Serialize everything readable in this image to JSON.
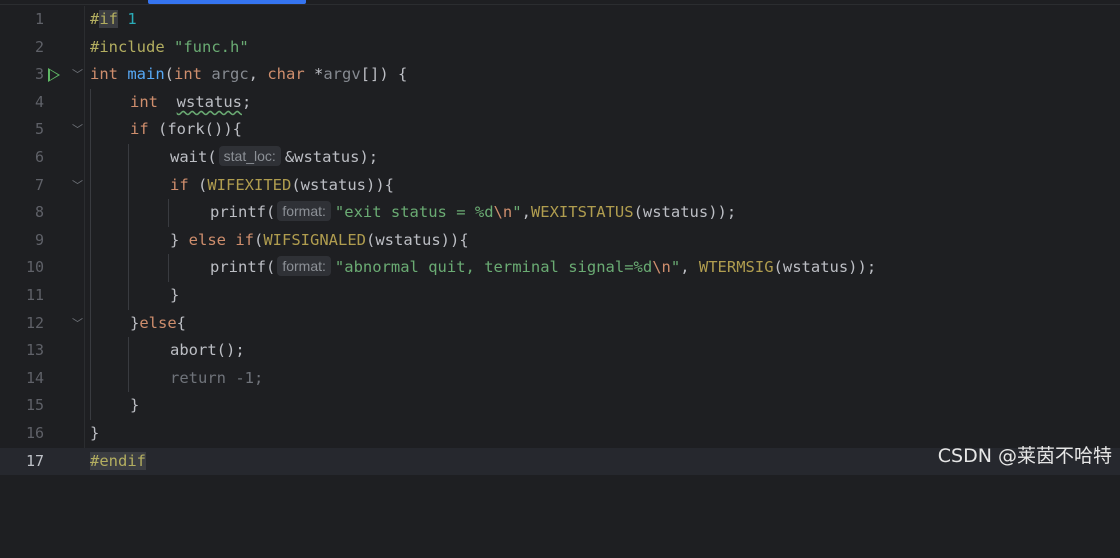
{
  "editor": {
    "current_line": 17,
    "lines": [
      {
        "num": "1"
      },
      {
        "num": "2"
      },
      {
        "num": "3"
      },
      {
        "num": "4"
      },
      {
        "num": "5"
      },
      {
        "num": "6"
      },
      {
        "num": "7"
      },
      {
        "num": "8"
      },
      {
        "num": "9"
      },
      {
        "num": "10"
      },
      {
        "num": "11"
      },
      {
        "num": "12"
      },
      {
        "num": "13"
      },
      {
        "num": "14"
      },
      {
        "num": "15"
      },
      {
        "num": "16"
      },
      {
        "num": "17"
      }
    ],
    "code": {
      "l1": {
        "a": "#",
        "b": "if",
        "c": " ",
        "d": "1"
      },
      "l2": {
        "a": "#include ",
        "b": "\"func.h\""
      },
      "l3": {
        "a": "int ",
        "b": "main",
        "c": "(",
        "d": "int ",
        "e": "argc",
        "f": ", ",
        "g": "char ",
        "h": "*",
        "i": "argv",
        "j": "[]) {"
      },
      "l4": {
        "a": "int  ",
        "b": "wstatus",
        "c": ";"
      },
      "l5": {
        "a": "if ",
        "b": "(fork()){"
      },
      "l6": {
        "a": "wait(",
        "hint": "stat_loc:",
        "b": "&wstatus);"
      },
      "l7": {
        "a": "if ",
        "b": "(",
        "c": "WIFEXITED",
        "d": "(wstatus)){"
      },
      "l8": {
        "a": "printf(",
        "hint": "format:",
        "b": "\"exit status = %d",
        "c": "\\n",
        "d": "\"",
        "e": ",",
        "f": "WEXITSTATUS",
        "g": "(wstatus));"
      },
      "l9": {
        "a": "} ",
        "b": "else if",
        "c": "(",
        "d": "WIFSIGNALED",
        "e": "(wstatus)){"
      },
      "l10": {
        "a": "printf(",
        "hint": "format:",
        "b": "\"abnormal quit, terminal signal=%d",
        "c": "\\n",
        "d": "\"",
        "e": ", ",
        "f": "WTERMSIG",
        "g": "(wstatus));"
      },
      "l11": {
        "a": "}"
      },
      "l12": {
        "a": "}",
        "b": "else",
        "c": "{"
      },
      "l13": {
        "a": "abort();"
      },
      "l14": {
        "a": "return -1;"
      },
      "l15": {
        "a": "}"
      },
      "l16": {
        "a": "}"
      },
      "l17": {
        "a": "#endif"
      }
    }
  },
  "watermark": "CSDN @莱茵不哈特",
  "colors": {
    "background": "#1e1f22",
    "keyword": "#cf8e6d",
    "function": "#56a8f5",
    "macro": "#b09d4f",
    "string": "#6aab73",
    "number": "#2aacb8",
    "run_icon": "#5fb865",
    "tab_indicator": "#3574f0"
  }
}
